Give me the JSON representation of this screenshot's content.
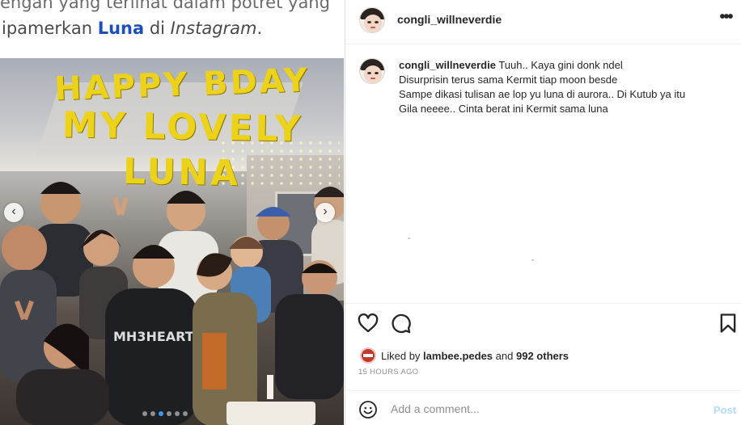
{
  "article": {
    "line1": "engan yang terlihat dalam potret yang",
    "line2_prefix": "ipamerkan ",
    "line2_link": "Luna",
    "line2_mid": " di ",
    "line2_italic": "Instagram",
    "line2_suffix": "."
  },
  "photo": {
    "caption_line1": "HAPPY BDAY",
    "caption_line2": "MY LOVELY LUNA",
    "prev_icon": "chevron-left-icon",
    "next_icon": "chevron-right-icon",
    "dot_count": 6,
    "active_dot": 3
  },
  "post": {
    "username": "congli_willneverdie",
    "more_icon": "more-horizontal-icon",
    "caption": {
      "username": "congli_willneverdie",
      "line1": "Tuuh.. Kaya gini donk ndel",
      "line2": "Disurprisin terus sama Kermit tiap moon besde",
      "line3": "Sampe dikasi tulisan ae lop yu luna di aurora.. Di Kutub ya itu",
      "line4": "Gila neeee.. Cinta berat ini Kermit sama luna"
    },
    "actions": {
      "like_icon": "heart-icon",
      "comment_icon": "comment-icon",
      "save_icon": "bookmark-icon"
    },
    "likes": {
      "prefix": "Liked by",
      "user": "lambee.pedes",
      "middle": "and",
      "others": "992 others"
    },
    "timestamp": "15 HOURS AGO",
    "comment_box": {
      "emoji_icon": "smile-icon",
      "placeholder": "Add a comment...",
      "post_label": "Post"
    }
  },
  "colors": {
    "link": "#1e4fb8",
    "caption_yellow": "#ecd21a",
    "post_disabled": "#b3dbff",
    "text": "#262626",
    "muted": "#8e8e8e"
  }
}
